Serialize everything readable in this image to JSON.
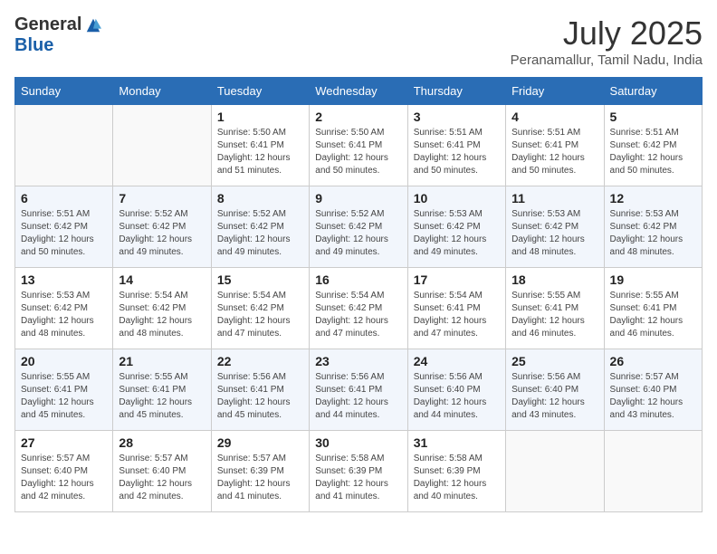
{
  "header": {
    "logo_general": "General",
    "logo_blue": "Blue",
    "month_title": "July 2025",
    "location": "Peranamallur, Tamil Nadu, India"
  },
  "weekdays": [
    "Sunday",
    "Monday",
    "Tuesday",
    "Wednesday",
    "Thursday",
    "Friday",
    "Saturday"
  ],
  "weeks": [
    [
      {
        "num": "",
        "sunrise": "",
        "sunset": "",
        "daylight": ""
      },
      {
        "num": "",
        "sunrise": "",
        "sunset": "",
        "daylight": ""
      },
      {
        "num": "1",
        "sunrise": "Sunrise: 5:50 AM",
        "sunset": "Sunset: 6:41 PM",
        "daylight": "Daylight: 12 hours and 51 minutes."
      },
      {
        "num": "2",
        "sunrise": "Sunrise: 5:50 AM",
        "sunset": "Sunset: 6:41 PM",
        "daylight": "Daylight: 12 hours and 50 minutes."
      },
      {
        "num": "3",
        "sunrise": "Sunrise: 5:51 AM",
        "sunset": "Sunset: 6:41 PM",
        "daylight": "Daylight: 12 hours and 50 minutes."
      },
      {
        "num": "4",
        "sunrise": "Sunrise: 5:51 AM",
        "sunset": "Sunset: 6:41 PM",
        "daylight": "Daylight: 12 hours and 50 minutes."
      },
      {
        "num": "5",
        "sunrise": "Sunrise: 5:51 AM",
        "sunset": "Sunset: 6:42 PM",
        "daylight": "Daylight: 12 hours and 50 minutes."
      }
    ],
    [
      {
        "num": "6",
        "sunrise": "Sunrise: 5:51 AM",
        "sunset": "Sunset: 6:42 PM",
        "daylight": "Daylight: 12 hours and 50 minutes."
      },
      {
        "num": "7",
        "sunrise": "Sunrise: 5:52 AM",
        "sunset": "Sunset: 6:42 PM",
        "daylight": "Daylight: 12 hours and 49 minutes."
      },
      {
        "num": "8",
        "sunrise": "Sunrise: 5:52 AM",
        "sunset": "Sunset: 6:42 PM",
        "daylight": "Daylight: 12 hours and 49 minutes."
      },
      {
        "num": "9",
        "sunrise": "Sunrise: 5:52 AM",
        "sunset": "Sunset: 6:42 PM",
        "daylight": "Daylight: 12 hours and 49 minutes."
      },
      {
        "num": "10",
        "sunrise": "Sunrise: 5:53 AM",
        "sunset": "Sunset: 6:42 PM",
        "daylight": "Daylight: 12 hours and 49 minutes."
      },
      {
        "num": "11",
        "sunrise": "Sunrise: 5:53 AM",
        "sunset": "Sunset: 6:42 PM",
        "daylight": "Daylight: 12 hours and 48 minutes."
      },
      {
        "num": "12",
        "sunrise": "Sunrise: 5:53 AM",
        "sunset": "Sunset: 6:42 PM",
        "daylight": "Daylight: 12 hours and 48 minutes."
      }
    ],
    [
      {
        "num": "13",
        "sunrise": "Sunrise: 5:53 AM",
        "sunset": "Sunset: 6:42 PM",
        "daylight": "Daylight: 12 hours and 48 minutes."
      },
      {
        "num": "14",
        "sunrise": "Sunrise: 5:54 AM",
        "sunset": "Sunset: 6:42 PM",
        "daylight": "Daylight: 12 hours and 48 minutes."
      },
      {
        "num": "15",
        "sunrise": "Sunrise: 5:54 AM",
        "sunset": "Sunset: 6:42 PM",
        "daylight": "Daylight: 12 hours and 47 minutes."
      },
      {
        "num": "16",
        "sunrise": "Sunrise: 5:54 AM",
        "sunset": "Sunset: 6:42 PM",
        "daylight": "Daylight: 12 hours and 47 minutes."
      },
      {
        "num": "17",
        "sunrise": "Sunrise: 5:54 AM",
        "sunset": "Sunset: 6:41 PM",
        "daylight": "Daylight: 12 hours and 47 minutes."
      },
      {
        "num": "18",
        "sunrise": "Sunrise: 5:55 AM",
        "sunset": "Sunset: 6:41 PM",
        "daylight": "Daylight: 12 hours and 46 minutes."
      },
      {
        "num": "19",
        "sunrise": "Sunrise: 5:55 AM",
        "sunset": "Sunset: 6:41 PM",
        "daylight": "Daylight: 12 hours and 46 minutes."
      }
    ],
    [
      {
        "num": "20",
        "sunrise": "Sunrise: 5:55 AM",
        "sunset": "Sunset: 6:41 PM",
        "daylight": "Daylight: 12 hours and 45 minutes."
      },
      {
        "num": "21",
        "sunrise": "Sunrise: 5:55 AM",
        "sunset": "Sunset: 6:41 PM",
        "daylight": "Daylight: 12 hours and 45 minutes."
      },
      {
        "num": "22",
        "sunrise": "Sunrise: 5:56 AM",
        "sunset": "Sunset: 6:41 PM",
        "daylight": "Daylight: 12 hours and 45 minutes."
      },
      {
        "num": "23",
        "sunrise": "Sunrise: 5:56 AM",
        "sunset": "Sunset: 6:41 PM",
        "daylight": "Daylight: 12 hours and 44 minutes."
      },
      {
        "num": "24",
        "sunrise": "Sunrise: 5:56 AM",
        "sunset": "Sunset: 6:40 PM",
        "daylight": "Daylight: 12 hours and 44 minutes."
      },
      {
        "num": "25",
        "sunrise": "Sunrise: 5:56 AM",
        "sunset": "Sunset: 6:40 PM",
        "daylight": "Daylight: 12 hours and 43 minutes."
      },
      {
        "num": "26",
        "sunrise": "Sunrise: 5:57 AM",
        "sunset": "Sunset: 6:40 PM",
        "daylight": "Daylight: 12 hours and 43 minutes."
      }
    ],
    [
      {
        "num": "27",
        "sunrise": "Sunrise: 5:57 AM",
        "sunset": "Sunset: 6:40 PM",
        "daylight": "Daylight: 12 hours and 42 minutes."
      },
      {
        "num": "28",
        "sunrise": "Sunrise: 5:57 AM",
        "sunset": "Sunset: 6:40 PM",
        "daylight": "Daylight: 12 hours and 42 minutes."
      },
      {
        "num": "29",
        "sunrise": "Sunrise: 5:57 AM",
        "sunset": "Sunset: 6:39 PM",
        "daylight": "Daylight: 12 hours and 41 minutes."
      },
      {
        "num": "30",
        "sunrise": "Sunrise: 5:58 AM",
        "sunset": "Sunset: 6:39 PM",
        "daylight": "Daylight: 12 hours and 41 minutes."
      },
      {
        "num": "31",
        "sunrise": "Sunrise: 5:58 AM",
        "sunset": "Sunset: 6:39 PM",
        "daylight": "Daylight: 12 hours and 40 minutes."
      },
      {
        "num": "",
        "sunrise": "",
        "sunset": "",
        "daylight": ""
      },
      {
        "num": "",
        "sunrise": "",
        "sunset": "",
        "daylight": ""
      }
    ]
  ]
}
